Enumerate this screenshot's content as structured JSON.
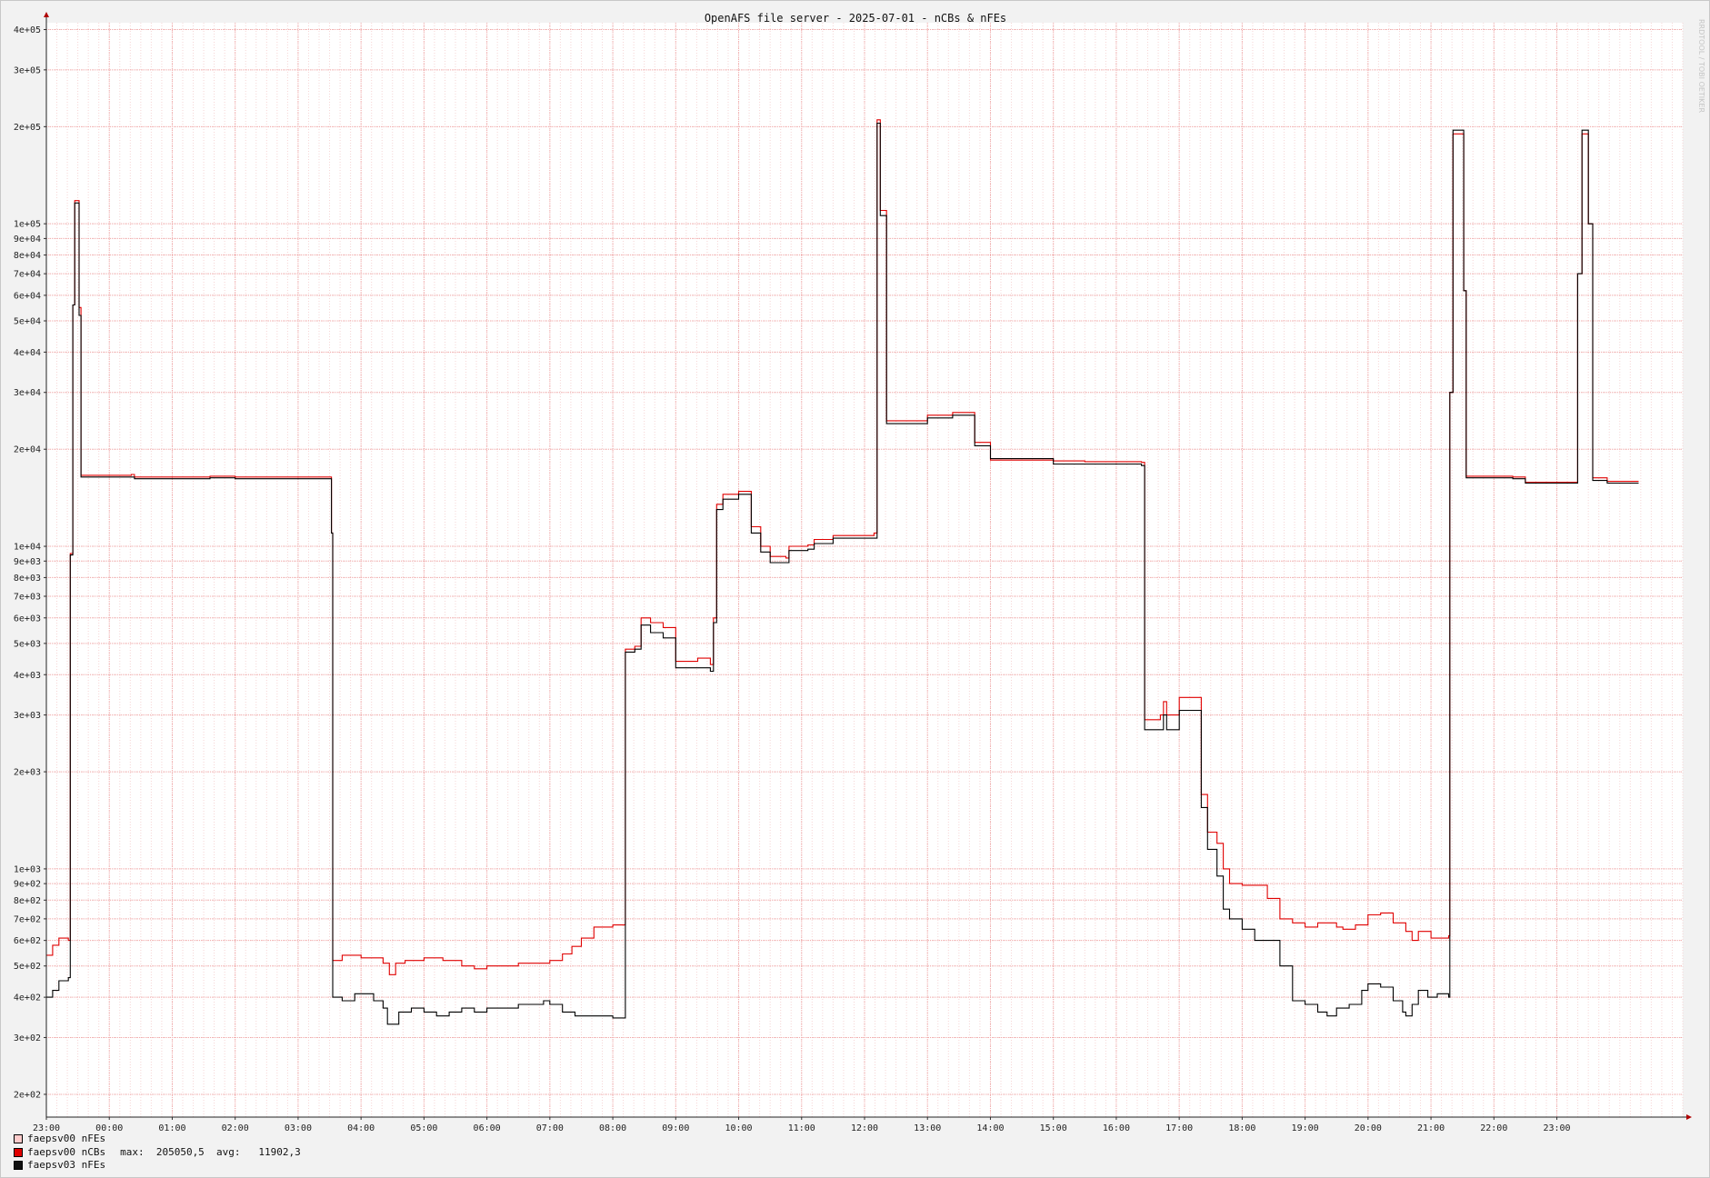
{
  "chart_data": {
    "type": "line",
    "title": "OpenAFS file server - 2025-07-01 - nCBs & nFEs",
    "y_scale": "log",
    "ylim": [
      170,
      420000
    ],
    "x_domain_hours": [
      23,
      49
    ],
    "y_ticks": [
      {
        "v": 400000,
        "label": "4e+05"
      },
      {
        "v": 300000,
        "label": "3e+05"
      },
      {
        "v": 200000,
        "label": "2e+05"
      },
      {
        "v": 100000,
        "label": "1e+05"
      },
      {
        "v": 90000,
        "label": "9e+04"
      },
      {
        "v": 80000,
        "label": "8e+04"
      },
      {
        "v": 70000,
        "label": "7e+04"
      },
      {
        "v": 60000,
        "label": "6e+04"
      },
      {
        "v": 50000,
        "label": "5e+04"
      },
      {
        "v": 40000,
        "label": "4e+04"
      },
      {
        "v": 30000,
        "label": "3e+04"
      },
      {
        "v": 20000,
        "label": "2e+04"
      },
      {
        "v": 10000,
        "label": "1e+04"
      },
      {
        "v": 9000,
        "label": "9e+03"
      },
      {
        "v": 8000,
        "label": "8e+03"
      },
      {
        "v": 7000,
        "label": "7e+03"
      },
      {
        "v": 6000,
        "label": "6e+03"
      },
      {
        "v": 5000,
        "label": "5e+03"
      },
      {
        "v": 4000,
        "label": "4e+03"
      },
      {
        "v": 3000,
        "label": "3e+03"
      },
      {
        "v": 2000,
        "label": "2e+03"
      },
      {
        "v": 1000,
        "label": "1e+03"
      },
      {
        "v": 900,
        "label": "9e+02"
      },
      {
        "v": 800,
        "label": "8e+02"
      },
      {
        "v": 700,
        "label": "7e+02"
      },
      {
        "v": 600,
        "label": "6e+02"
      },
      {
        "v": 500,
        "label": "5e+02"
      },
      {
        "v": 400,
        "label": "4e+02"
      },
      {
        "v": 300,
        "label": "3e+02"
      },
      {
        "v": 200,
        "label": "2e+02"
      }
    ],
    "x_ticks": [
      {
        "h": 23,
        "label": "23:00"
      },
      {
        "h": 24,
        "label": "00:00"
      },
      {
        "h": 25,
        "label": "01:00"
      },
      {
        "h": 26,
        "label": "02:00"
      },
      {
        "h": 27,
        "label": "03:00"
      },
      {
        "h": 28,
        "label": "04:00"
      },
      {
        "h": 29,
        "label": "05:00"
      },
      {
        "h": 30,
        "label": "06:00"
      },
      {
        "h": 31,
        "label": "07:00"
      },
      {
        "h": 32,
        "label": "08:00"
      },
      {
        "h": 33,
        "label": "09:00"
      },
      {
        "h": 34,
        "label": "10:00"
      },
      {
        "h": 35,
        "label": "11:00"
      },
      {
        "h": 36,
        "label": "12:00"
      },
      {
        "h": 37,
        "label": "13:00"
      },
      {
        "h": 38,
        "label": "14:00"
      },
      {
        "h": 39,
        "label": "15:00"
      },
      {
        "h": 40,
        "label": "16:00"
      },
      {
        "h": 41,
        "label": "17:00"
      },
      {
        "h": 42,
        "label": "18:00"
      },
      {
        "h": 43,
        "label": "19:00"
      },
      {
        "h": 44,
        "label": "20:00"
      },
      {
        "h": 45,
        "label": "21:00"
      },
      {
        "h": 46,
        "label": "22:00"
      },
      {
        "h": 47,
        "label": "23:00"
      }
    ],
    "series": [
      {
        "name": "faepsv00 nFEs",
        "color": "#ffcccc",
        "points": []
      },
      {
        "name": "faepsv00 nCBs",
        "color": "#e00000",
        "points": [
          [
            23.0,
            540
          ],
          [
            23.1,
            580
          ],
          [
            23.2,
            610
          ],
          [
            23.35,
            600
          ],
          [
            23.38,
            9500
          ],
          [
            23.42,
            56000
          ],
          [
            23.45,
            118000
          ],
          [
            23.5,
            118000
          ],
          [
            23.52,
            55000
          ],
          [
            23.55,
            16600
          ],
          [
            24.0,
            16600
          ],
          [
            24.35,
            16700
          ],
          [
            24.4,
            16400
          ],
          [
            25.0,
            16400
          ],
          [
            25.6,
            16500
          ],
          [
            26.0,
            16400
          ],
          [
            27.0,
            16400
          ],
          [
            27.52,
            16400
          ],
          [
            27.53,
            11000
          ],
          [
            27.55,
            520
          ],
          [
            27.7,
            540
          ],
          [
            28.0,
            530
          ],
          [
            28.2,
            530
          ],
          [
            28.35,
            510
          ],
          [
            28.45,
            470
          ],
          [
            28.55,
            510
          ],
          [
            28.7,
            520
          ],
          [
            29.0,
            530
          ],
          [
            29.3,
            520
          ],
          [
            29.6,
            500
          ],
          [
            29.8,
            490
          ],
          [
            30.0,
            500
          ],
          [
            30.3,
            500
          ],
          [
            30.5,
            510
          ],
          [
            30.7,
            510
          ],
          [
            31.0,
            520
          ],
          [
            31.1,
            520
          ],
          [
            31.2,
            545
          ],
          [
            31.35,
            575
          ],
          [
            31.5,
            610
          ],
          [
            31.7,
            660
          ],
          [
            32.0,
            670
          ],
          [
            32.18,
            670
          ],
          [
            32.2,
            4800
          ],
          [
            32.35,
            4900
          ],
          [
            32.45,
            6000
          ],
          [
            32.6,
            5800
          ],
          [
            32.8,
            5600
          ],
          [
            33.0,
            4400
          ],
          [
            33.2,
            4400
          ],
          [
            33.35,
            4500
          ],
          [
            33.55,
            4300
          ],
          [
            33.6,
            6000
          ],
          [
            33.65,
            13500
          ],
          [
            33.75,
            14500
          ],
          [
            34.0,
            14800
          ],
          [
            34.2,
            11500
          ],
          [
            34.35,
            10000
          ],
          [
            34.5,
            9300
          ],
          [
            34.75,
            9200
          ],
          [
            34.8,
            10000
          ],
          [
            35.1,
            10100
          ],
          [
            35.2,
            10500
          ],
          [
            35.5,
            10800
          ],
          [
            35.9,
            10800
          ],
          [
            36.15,
            11000
          ],
          [
            36.2,
            210000
          ],
          [
            36.25,
            110000
          ],
          [
            36.35,
            24500
          ],
          [
            36.6,
            24500
          ],
          [
            36.9,
            24500
          ],
          [
            37.0,
            25500
          ],
          [
            37.4,
            26000
          ],
          [
            37.5,
            26000
          ],
          [
            37.75,
            21000
          ],
          [
            38.0,
            18500
          ],
          [
            38.5,
            18500
          ],
          [
            39.0,
            18400
          ],
          [
            39.5,
            18300
          ],
          [
            40.0,
            18300
          ],
          [
            40.4,
            18200
          ],
          [
            40.45,
            2900
          ],
          [
            40.7,
            3000
          ],
          [
            40.75,
            3300
          ],
          [
            40.8,
            3000
          ],
          [
            41.0,
            3400
          ],
          [
            41.3,
            3400
          ],
          [
            41.35,
            1700
          ],
          [
            41.45,
            1300
          ],
          [
            41.6,
            1200
          ],
          [
            41.7,
            1000
          ],
          [
            41.8,
            900
          ],
          [
            42.0,
            890
          ],
          [
            42.2,
            890
          ],
          [
            42.4,
            810
          ],
          [
            42.6,
            700
          ],
          [
            42.8,
            680
          ],
          [
            43.0,
            660
          ],
          [
            43.2,
            680
          ],
          [
            43.5,
            660
          ],
          [
            43.6,
            650
          ],
          [
            43.8,
            670
          ],
          [
            44.0,
            720
          ],
          [
            44.2,
            730
          ],
          [
            44.4,
            680
          ],
          [
            44.6,
            640
          ],
          [
            44.7,
            600
          ],
          [
            44.8,
            640
          ],
          [
            45.0,
            610
          ],
          [
            45.28,
            620
          ],
          [
            45.3,
            30000
          ],
          [
            45.35,
            190000
          ],
          [
            45.45,
            190000
          ],
          [
            45.52,
            62000
          ],
          [
            45.56,
            16500
          ],
          [
            46.0,
            16500
          ],
          [
            46.3,
            16400
          ],
          [
            46.5,
            15800
          ],
          [
            47.0,
            15800
          ],
          [
            47.3,
            15800
          ],
          [
            47.33,
            70000
          ],
          [
            47.4,
            190000
          ],
          [
            47.5,
            100000
          ],
          [
            47.57,
            16300
          ],
          [
            47.7,
            16300
          ],
          [
            47.8,
            15900
          ],
          [
            48.3,
            15900
          ]
        ]
      },
      {
        "name": "faepsv03 nFEs",
        "color": "#000000",
        "points": [
          [
            23.0,
            400
          ],
          [
            23.1,
            420
          ],
          [
            23.2,
            450
          ],
          [
            23.35,
            460
          ],
          [
            23.38,
            9400
          ],
          [
            23.42,
            56000
          ],
          [
            23.45,
            116000
          ],
          [
            23.5,
            116000
          ],
          [
            23.52,
            52000
          ],
          [
            23.55,
            16400
          ],
          [
            24.0,
            16400
          ],
          [
            24.35,
            16400
          ],
          [
            24.4,
            16200
          ],
          [
            25.0,
            16200
          ],
          [
            25.6,
            16300
          ],
          [
            26.0,
            16200
          ],
          [
            27.0,
            16200
          ],
          [
            27.52,
            16200
          ],
          [
            27.53,
            11000
          ],
          [
            27.55,
            400
          ],
          [
            27.7,
            390
          ],
          [
            27.9,
            410
          ],
          [
            28.2,
            390
          ],
          [
            28.35,
            370
          ],
          [
            28.42,
            330
          ],
          [
            28.6,
            360
          ],
          [
            28.8,
            370
          ],
          [
            29.0,
            360
          ],
          [
            29.2,
            350
          ],
          [
            29.4,
            360
          ],
          [
            29.6,
            370
          ],
          [
            29.8,
            360
          ],
          [
            30.0,
            370
          ],
          [
            30.3,
            370
          ],
          [
            30.5,
            380
          ],
          [
            30.7,
            380
          ],
          [
            30.9,
            390
          ],
          [
            31.0,
            380
          ],
          [
            31.2,
            360
          ],
          [
            31.4,
            350
          ],
          [
            31.6,
            350
          ],
          [
            32.0,
            345
          ],
          [
            32.18,
            345
          ],
          [
            32.2,
            4700
          ],
          [
            32.35,
            4800
          ],
          [
            32.45,
            5700
          ],
          [
            32.6,
            5400
          ],
          [
            32.8,
            5200
          ],
          [
            33.0,
            4200
          ],
          [
            33.2,
            4200
          ],
          [
            33.35,
            4200
          ],
          [
            33.55,
            4100
          ],
          [
            33.6,
            5800
          ],
          [
            33.65,
            13000
          ],
          [
            33.75,
            14000
          ],
          [
            34.0,
            14500
          ],
          [
            34.2,
            11000
          ],
          [
            34.35,
            9600
          ],
          [
            34.5,
            8900
          ],
          [
            34.75,
            8900
          ],
          [
            34.8,
            9700
          ],
          [
            35.1,
            9800
          ],
          [
            35.2,
            10200
          ],
          [
            35.5,
            10600
          ],
          [
            35.9,
            10600
          ],
          [
            36.15,
            10600
          ],
          [
            36.2,
            205000
          ],
          [
            36.25,
            106000
          ],
          [
            36.35,
            24000
          ],
          [
            36.6,
            24000
          ],
          [
            36.9,
            24000
          ],
          [
            37.0,
            25000
          ],
          [
            37.4,
            25500
          ],
          [
            37.5,
            25500
          ],
          [
            37.75,
            20500
          ],
          [
            38.0,
            18700
          ],
          [
            38.5,
            18700
          ],
          [
            39.0,
            18000
          ],
          [
            39.5,
            18000
          ],
          [
            40.0,
            18000
          ],
          [
            40.4,
            17800
          ],
          [
            40.45,
            2700
          ],
          [
            40.7,
            2700
          ],
          [
            40.75,
            3000
          ],
          [
            40.8,
            2700
          ],
          [
            41.0,
            3100
          ],
          [
            41.3,
            3100
          ],
          [
            41.35,
            1550
          ],
          [
            41.45,
            1150
          ],
          [
            41.6,
            950
          ],
          [
            41.7,
            750
          ],
          [
            41.8,
            700
          ],
          [
            42.0,
            650
          ],
          [
            42.2,
            600
          ],
          [
            42.4,
            600
          ],
          [
            42.6,
            500
          ],
          [
            42.8,
            390
          ],
          [
            43.0,
            380
          ],
          [
            43.2,
            360
          ],
          [
            43.35,
            350
          ],
          [
            43.5,
            370
          ],
          [
            43.7,
            380
          ],
          [
            43.9,
            420
          ],
          [
            44.0,
            440
          ],
          [
            44.2,
            430
          ],
          [
            44.4,
            390
          ],
          [
            44.55,
            360
          ],
          [
            44.6,
            350
          ],
          [
            44.7,
            380
          ],
          [
            44.8,
            420
          ],
          [
            44.95,
            400
          ],
          [
            45.1,
            410
          ],
          [
            45.28,
            400
          ],
          [
            45.3,
            30000
          ],
          [
            45.35,
            195000
          ],
          [
            45.45,
            195000
          ],
          [
            45.52,
            62000
          ],
          [
            45.56,
            16300
          ],
          [
            46.0,
            16300
          ],
          [
            46.3,
            16200
          ],
          [
            46.5,
            15700
          ],
          [
            47.0,
            15700
          ],
          [
            47.3,
            15700
          ],
          [
            47.33,
            70000
          ],
          [
            47.4,
            195000
          ],
          [
            47.5,
            100000
          ],
          [
            47.57,
            16000
          ],
          [
            47.7,
            16000
          ],
          [
            47.8,
            15700
          ],
          [
            48.3,
            15700
          ]
        ]
      }
    ],
    "legend": {
      "placement": "bottom-left",
      "entries": [
        {
          "label": "faepsv00 nFEs",
          "swatch": "#ffcccc",
          "stats": ""
        },
        {
          "label": "faepsv00 nCBs",
          "swatch": "#e00000",
          "stats": "max:  205050,5  avg:   11902,3"
        },
        {
          "label": "faepsv03 nFEs",
          "swatch": "#111111",
          "stats": ""
        }
      ]
    },
    "watermark": "RRDTOOL / TOBI OETIKER"
  }
}
